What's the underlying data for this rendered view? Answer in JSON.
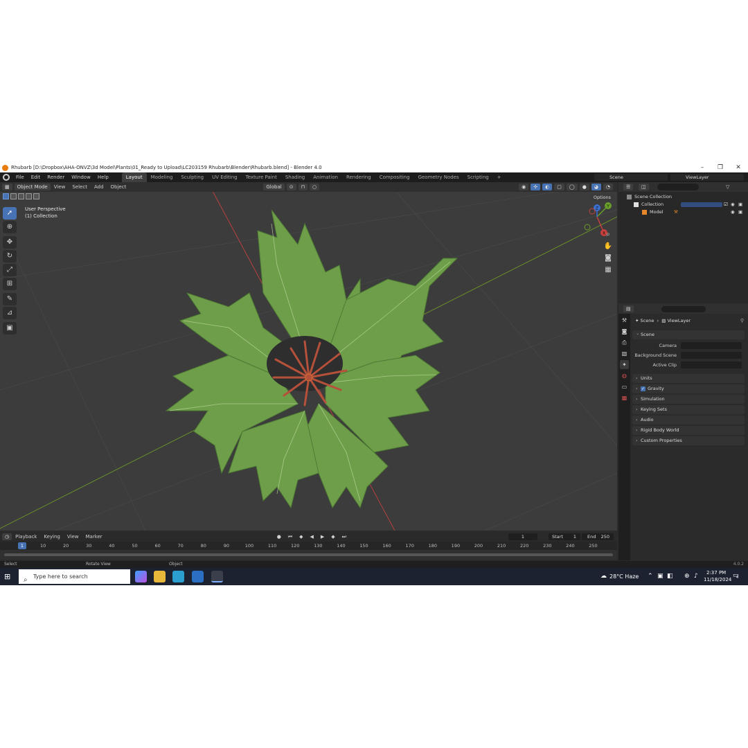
{
  "window": {
    "title": "Rhubarb [D:\\Dropbox\\AHA-ONVZ\\3d Model\\Plants\\01_Ready to Upload\\LC203159 Rhubarb\\Blender\\Rhubarb.blend] - Blender 4.0",
    "controls": [
      "–",
      "❐",
      "✕"
    ]
  },
  "menu": [
    "File",
    "Edit",
    "Render",
    "Window",
    "Help"
  ],
  "workspaces": [
    "Layout",
    "Modeling",
    "Sculpting",
    "UV Editing",
    "Texture Paint",
    "Shading",
    "Animation",
    "Rendering",
    "Compositing",
    "Geometry Nodes",
    "Scripting",
    "+"
  ],
  "active_workspace": "Layout",
  "scene_name": "Scene",
  "view_layer": "ViewLayer",
  "viewport": {
    "mode": "Object Mode",
    "menus": [
      "View",
      "Select",
      "Add",
      "Object"
    ],
    "transform_orientation": "Global",
    "label_perspective": "User Perspective",
    "label_collection": "(1) Collection",
    "options": "Options"
  },
  "gizmo": {
    "x": "X",
    "y": "Y",
    "z": "Z"
  },
  "toolbar_icons": [
    "select-box-icon",
    "cursor-icon",
    "move-icon",
    "rotate-icon",
    "scale-icon",
    "transform-icon",
    "annotate-icon",
    "measure-icon",
    "add-cube-icon"
  ],
  "timeline": {
    "menus": [
      "Playback",
      "Keying",
      "View",
      "Marker"
    ],
    "current_frame": "1",
    "start_label": "Start",
    "start": "1",
    "end_label": "End",
    "end": "250",
    "ticks": [
      "10",
      "20",
      "30",
      "40",
      "50",
      "60",
      "70",
      "80",
      "90",
      "100",
      "110",
      "120",
      "130",
      "140",
      "150",
      "160",
      "170",
      "180",
      "190",
      "200",
      "210",
      "220",
      "230",
      "240",
      "250"
    ]
  },
  "status": {
    "select": "Select",
    "rotate": "Rotate View",
    "object": "Object",
    "version": "4.0.2"
  },
  "outliner": {
    "root": "Scene Collection",
    "items": [
      {
        "label": "Collection"
      },
      {
        "label": "Model"
      }
    ]
  },
  "properties": {
    "breadcrumb_scene": "Scene",
    "breadcrumb_sep": "›",
    "breadcrumb_layer": "ViewLayer",
    "section_scene": "Scene",
    "camera_label": "Camera",
    "background_label": "Background Scene",
    "clip_label": "Active Clip",
    "panels": [
      "Units",
      "Gravity",
      "Simulation",
      "Keying Sets",
      "Audio",
      "Rigid Body World",
      "Custom Properties"
    ]
  },
  "taskbar": {
    "search_placeholder": "Type here to search",
    "weather": "28°C  Haze",
    "time": "2:37 PM",
    "date": "11/18/2024",
    "notifications": "4"
  },
  "colors": {
    "accent": "#4772b3",
    "leaf": "#6f9e4a",
    "stem": "#b5513a",
    "x_axis": "#b8413f",
    "y_axis": "#6a8f2a"
  }
}
